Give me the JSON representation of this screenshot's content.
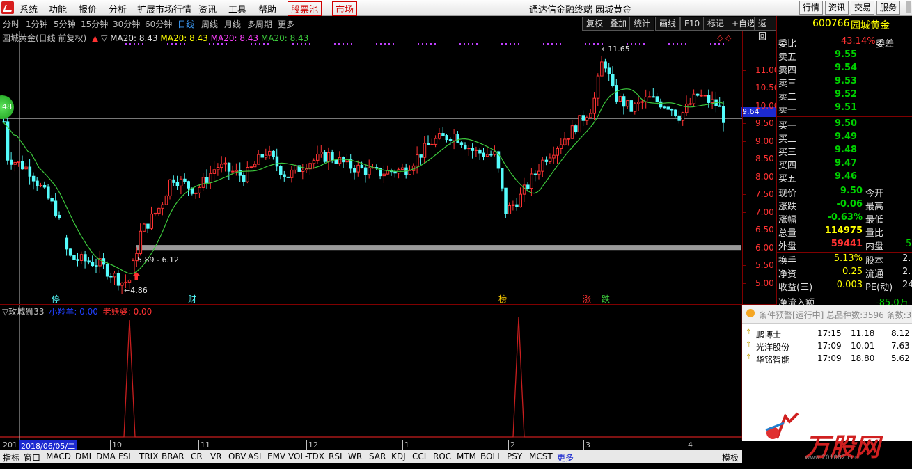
{
  "menu": {
    "items": [
      "系统",
      "功能",
      "报价",
      "分析",
      "扩展市场行情",
      "资讯",
      "工具",
      "帮助"
    ],
    "red_items": [
      "股票池",
      "市场"
    ],
    "title": "通达信金融终端  园城黄金",
    "right_buttons": [
      "行情",
      "资讯",
      "交易",
      "服务"
    ]
  },
  "periods": {
    "items": [
      "分时",
      "1分钟",
      "5分钟",
      "15分钟",
      "30分钟",
      "60分钟",
      "日线",
      "周线",
      "月线",
      "多周期",
      "更多"
    ],
    "active": "日线"
  },
  "chart_tools": [
    "复权",
    "叠加",
    "统计",
    "画线",
    "F10",
    "标记",
    "+自选",
    "返回"
  ],
  "main_legend": {
    "name": "园城黄金(日线 前复权)",
    "ma1": "MA20: 8.43",
    "ma2": "MA20: 8.43",
    "ma3": "MA20: 8.43",
    "ma4": "MA20: 8.43"
  },
  "annotations": {
    "high": "11.65",
    "low": "4.86",
    "range": "5.89 - 6.12",
    "current_price_tag": "9.64",
    "circle_label": "48"
  },
  "markers": [
    "停",
    "财",
    "榜",
    "涨",
    "跌"
  ],
  "indicator_legend": {
    "name": "▽玫城狮33",
    "line1": "小羚羊: 0.00",
    "line2": "老妖婆: 0.00"
  },
  "y_axis": [
    "11.00",
    "10.50",
    "10.00",
    "9.50",
    "9.00",
    "8.50",
    "8.00",
    "7.50",
    "7.00",
    "6.50",
    "6.00",
    "5.50",
    "5.00"
  ],
  "x_axis": {
    "selected_date": "2018/06/05/二",
    "prefix": "201",
    "months": [
      "10",
      "11",
      "12",
      "1",
      "2",
      "3",
      "4"
    ]
  },
  "quote": {
    "code": "600766",
    "name": "园城黄金",
    "weibi_label": "委比",
    "weibi": "43.14%",
    "weicha_label": "委差",
    "asks": [
      {
        "label": "卖五",
        "price": "9.55"
      },
      {
        "label": "卖四",
        "price": "9.54"
      },
      {
        "label": "卖三",
        "price": "9.53"
      },
      {
        "label": "卖二",
        "price": "9.52"
      },
      {
        "label": "卖一",
        "price": "9.51"
      }
    ],
    "bids": [
      {
        "label": "买一",
        "price": "9.50"
      },
      {
        "label": "买二",
        "price": "9.49"
      },
      {
        "label": "买三",
        "price": "9.48"
      },
      {
        "label": "买四",
        "price": "9.47"
      },
      {
        "label": "买五",
        "price": "9.46"
      }
    ],
    "stats": [
      {
        "label": "现价",
        "value": "9.50",
        "label2": "今开",
        "value2": ""
      },
      {
        "label": "涨跌",
        "value": "-0.06",
        "label2": "最高",
        "value2": ""
      },
      {
        "label": "涨幅",
        "value": "-0.63%",
        "label2": "最低",
        "value2": ""
      },
      {
        "label": "总量",
        "value": "114975",
        "label2": "量比",
        "value2": ""
      },
      {
        "label": "外盘",
        "value": "59441",
        "label2": "内盘",
        "value2": "5"
      }
    ],
    "stats2": [
      {
        "label": "换手",
        "value": "5.13%",
        "label2": "股本",
        "value2": "2."
      },
      {
        "label": "净资",
        "value": "0.25",
        "label2": "流通",
        "value2": "2."
      },
      {
        "label": "收益(三)",
        "value": "0.003",
        "label2": "PE(动)",
        "value2": "24"
      }
    ],
    "net_inflow_label": "净流入额",
    "net_inflow": "-85.0万"
  },
  "alert": {
    "title": "条件预警[运行中] 总品种数:3596 条数:3",
    "rows": [
      {
        "name": "鹏博士",
        "time": "17:15",
        "price": "11.18",
        "pct": "8.12"
      },
      {
        "name": "光洋股份",
        "time": "17:09",
        "price": "10.01",
        "pct": "7.63"
      },
      {
        "name": "华铭智能",
        "time": "17:09",
        "price": "18.80",
        "pct": "5.62"
      }
    ]
  },
  "watermark": {
    "text": "万股网",
    "url": "www.201082.com"
  },
  "bottom_tabs": [
    "指标",
    "窗口",
    "MACD",
    "DMI",
    "DMA",
    "FSL",
    "TRIX",
    "BRAR",
    "CR",
    "VR",
    "OBV",
    "ASI",
    "EMV",
    "VOL-TDX",
    "RSI",
    "WR",
    "SAR",
    "KDJ",
    "CCI",
    "ROC",
    "MTM",
    "BOLL",
    "PSY",
    "MCST",
    "更多",
    "模板"
  ],
  "colors": {
    "up": "#ff3232",
    "down": "#54fcfc",
    "ma": "#3cc83c",
    "indicator": "#c81e1e"
  }
}
